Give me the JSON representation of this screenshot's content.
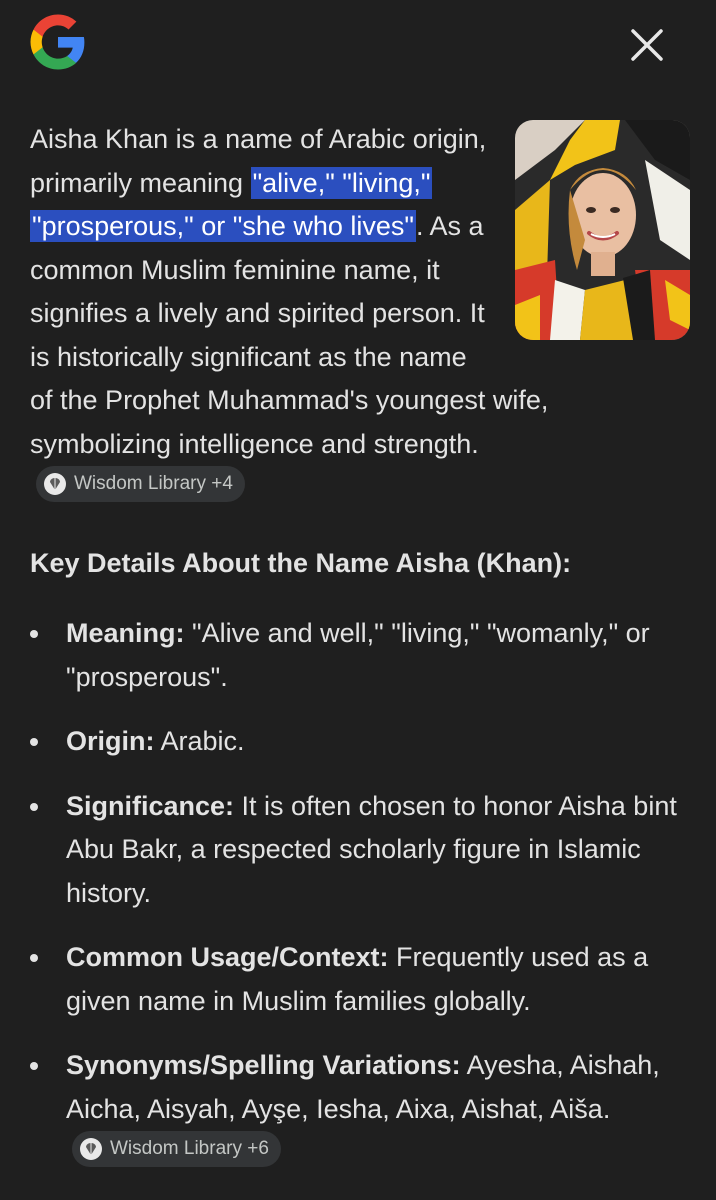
{
  "header": {
    "logo_icon": "google-g-logo",
    "close_icon": "close-x-icon"
  },
  "summary": {
    "part1": "Aisha Khan is a name of Arabic origin, primarily meaning ",
    "highlight": "\"alive,\" \"living,\" \"prosperous,\" or \"she who lives\"",
    "part2": ". As a common Muslim feminine name, it signifies a lively and spirited person. It is historically significant as the name of the Prophet Muhammad's youngest wife, symbolizing intelligence and strength.",
    "source_chip": "Wisdom Library +4",
    "highlight_color": "#2b4fbf"
  },
  "details": {
    "heading": "Key Details About the Name Aisha (Khan):",
    "items": [
      {
        "label": "Meaning:",
        "text": " \"Alive and well,\" \"living,\" \"womanly,\" or \"prosperous\"."
      },
      {
        "label": "Origin:",
        "text": " Arabic."
      },
      {
        "label": "Significance:",
        "text": " It is often chosen to honor Aisha bint Abu Bakr, a respected scholarly figure in Islamic history."
      },
      {
        "label": "Common Usage/Context:",
        "text": " Frequently used as a given name in Muslim families globally."
      },
      {
        "label": "Synonyms/Spelling Variations:",
        "text": " Ayesha, Aishah, Aicha, Aisyah, Ayşe, Iesha, Aixa, Aishat, Aiša.",
        "chip": "Wisdom Library +6"
      }
    ]
  },
  "colors": {
    "background": "#1f1f1f",
    "text": "#e3e3e3",
    "chip_bg": "#333537"
  }
}
